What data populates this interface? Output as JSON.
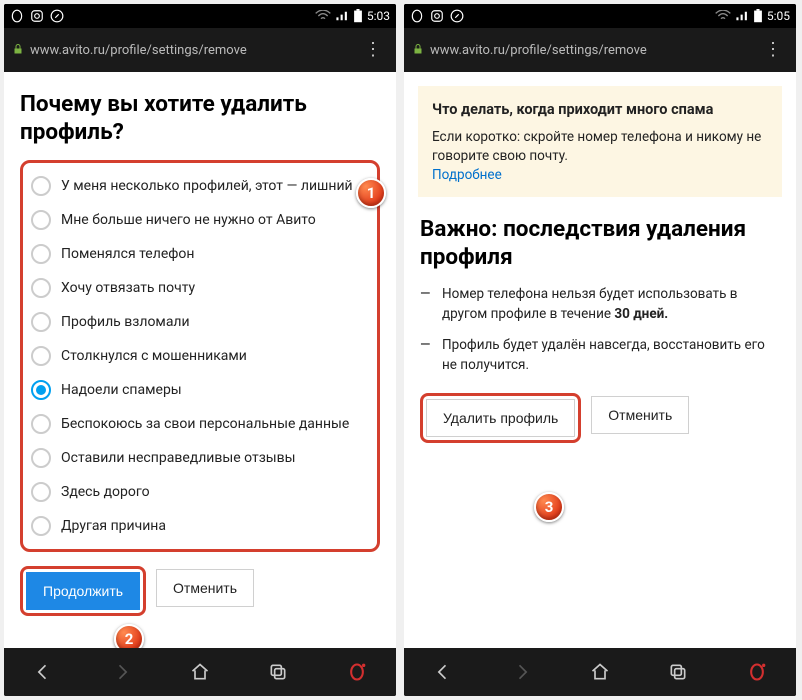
{
  "phone1": {
    "time": "5:03",
    "url": "www.avito.ru/profile/settings/remove",
    "heading": "Почему вы хотите удалить профиль?",
    "options": [
      "У меня несколько профилей, этот — лишний",
      "Мне больше ничего не нужно от Авито",
      "Поменялся телефон",
      "Хочу отвязать почту",
      "Профиль взломали",
      "Столкнулся с мошенниками",
      "Надоели спамеры",
      "Беспокоюсь за свои персональные данные",
      "Оставили несправедливые отзывы",
      "Здесь дорого",
      "Другая причина"
    ],
    "selected_index": 6,
    "continue_label": "Продолжить",
    "cancel_label": "Отменить"
  },
  "phone2": {
    "time": "5:05",
    "url": "www.avito.ru/profile/settings/remove",
    "info_title": "Что делать, когда приходит много спама",
    "info_body": "Если коротко: скройте номер телефона и никому не говорите свою почту.",
    "info_link": "Подробнее",
    "heading": "Важно: последствия удаления профиля",
    "bullet1_a": "Номер телефона нельзя будет использовать в другом профиле в течение ",
    "bullet1_b": "30 дней.",
    "bullet2": "Профиль будет удалён навсегда, восстановить его не получится.",
    "delete_label": "Удалить профиль",
    "cancel_label": "Отменить"
  },
  "badges": {
    "b1": "1",
    "b2": "2",
    "b3": "3"
  }
}
